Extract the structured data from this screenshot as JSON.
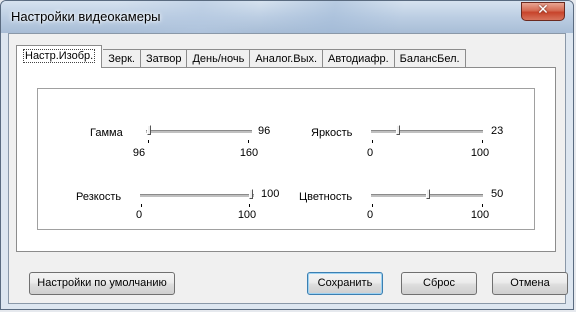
{
  "window": {
    "title": "Настройки видеокамеры",
    "close_symbol": "✕"
  },
  "tabs": [
    {
      "label": "Настр.Изобр.",
      "active": true
    },
    {
      "label": "Зерк.",
      "active": false
    },
    {
      "label": "Затвор",
      "active": false
    },
    {
      "label": "День/ночь",
      "active": false
    },
    {
      "label": "Аналог.Вых.",
      "active": false
    },
    {
      "label": "Автодиафр.",
      "active": false
    },
    {
      "label": "БалансБел.",
      "active": false
    }
  ],
  "sliders": {
    "gamma": {
      "label": "Гамма",
      "value": "96",
      "min": "96",
      "max": "160",
      "fraction": 0.0
    },
    "sharpness": {
      "label": "Резкость",
      "value": "100",
      "min": "0",
      "max": "100",
      "fraction": 1.0
    },
    "brightness": {
      "label": "Яркость",
      "value": "23",
      "min": "0",
      "max": "100",
      "fraction": 0.23
    },
    "saturation": {
      "label": "Цветность",
      "value": "50",
      "min": "0",
      "max": "100",
      "fraction": 0.5
    }
  },
  "buttons": {
    "defaults": "Настройки по умолчанию",
    "save": "Сохранить",
    "reset": "Сброс",
    "cancel": "Отмена"
  },
  "colors": {
    "close_button": "#c7442b",
    "default_button_border": "#3c7fb1"
  }
}
